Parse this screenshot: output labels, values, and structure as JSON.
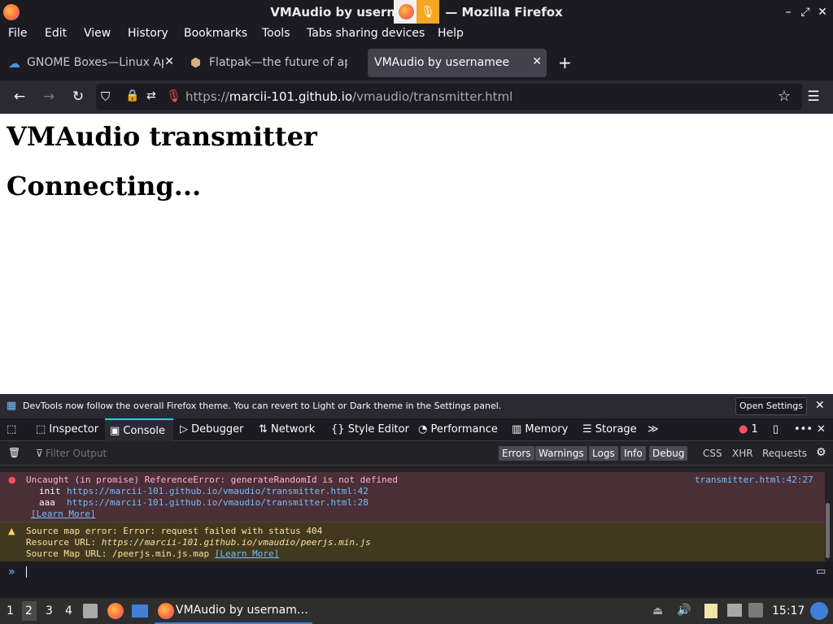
{
  "window": {
    "title_left": "VMAudio by usern",
    "title_right": "— Mozilla Firefox"
  },
  "menu": [
    "File",
    "Edit",
    "View",
    "History",
    "Bookmarks",
    "Tools",
    "Tabs sharing devices",
    "Help"
  ],
  "tabs": [
    {
      "label": "GNOME Boxes—Linux Ap"
    },
    {
      "label": "Flatpak—the future of ap"
    },
    {
      "label": "VMAudio by usernamee"
    }
  ],
  "urlbar": {
    "scheme": "https://",
    "host": "marcii-101.github.io",
    "path": "/vmaudio/transmitter.html"
  },
  "page": {
    "heading": "VMAudio transmitter",
    "status": "Connecting..."
  },
  "devtools": {
    "notice": "DevTools now follow the overall Firefox theme. You can revert to Light or Dark theme in the Settings panel.",
    "notice_button": "Open Settings",
    "tabs": [
      "Inspector",
      "Console",
      "Debugger",
      "Network",
      "Style Editor",
      "Performance",
      "Memory",
      "Storage"
    ],
    "error_count": "1",
    "filter_placeholder": "Filter Output",
    "filters": [
      "Errors",
      "Warnings",
      "Logs",
      "Info",
      "Debug"
    ],
    "filter_extra": [
      "CSS",
      "XHR",
      "Requests"
    ],
    "error": {
      "message": "Uncaught (in promise) ReferenceError: generateRandomId is not defined",
      "location": "transmitter.html:42:27",
      "stack": [
        {
          "fn": "init",
          "url": "https://marcii-101.github.io/vmaudio/transmitter.html:42"
        },
        {
          "fn": "aaa",
          "url": "https://marcii-101.github.io/vmaudio/transmitter.html:28"
        }
      ],
      "learn_more": "[Learn More]"
    },
    "warning": {
      "line1": "Source map error: Error: request failed with status 404",
      "line2_label": "Resource URL: ",
      "line2_url": "https://marcii-101.github.io/vmaudio/peerjs.min.js",
      "line3_label": "Source Map URL: /peerjs.min.js.map ",
      "learn_more": "[Learn More]"
    }
  },
  "taskbar": {
    "workspaces": [
      "1",
      "2",
      "3",
      "4"
    ],
    "task_label": "VMAudio by usernam…",
    "clock": "15:17"
  },
  "colors": {
    "accent": "#00ddff",
    "error_bg": "#4b2f36",
    "warning_bg": "#42381f",
    "link": "#75bfff"
  }
}
